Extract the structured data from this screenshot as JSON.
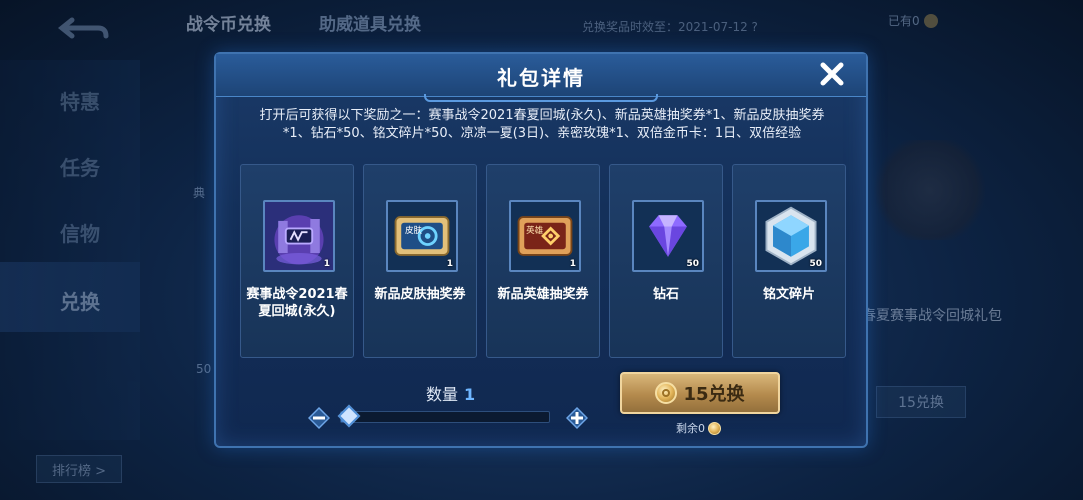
{
  "background": {
    "tabs": [
      "战令币兑换",
      "助威道具兑换"
    ],
    "top_info": "兑换奖品时效至：2021-07-12 ?",
    "top_currency": "已有0",
    "side_nav": [
      "特惠",
      "任务",
      "信物",
      "兑换"
    ],
    "rank_button": "排行榜 >",
    "left_badge": "50",
    "left_label": "典",
    "right_card_name": "赛事战令回城礼包",
    "right_card_name_visible": "春夏赛事战令回城礼包",
    "right_button": "15兑换"
  },
  "modal": {
    "title": "礼包详情",
    "description": "打开后可获得以下奖励之一：赛事战令2021春夏回城(永久)、新品英雄抽奖券*1、新品皮肤抽奖券*1、钻石*50、铭文碎片*50、凉凉一夏(3日)、亲密玫瑰*1、双倍金币卡：1日、双倍经验",
    "items": [
      {
        "name": "赛事战令2021春夏回城(永久)",
        "count": "1",
        "icon": "recall-effect-icon"
      },
      {
        "name": "新品皮肤抽奖券",
        "count": "1",
        "icon": "skin-ticket-icon"
      },
      {
        "name": "新品英雄抽奖券",
        "count": "1",
        "icon": "hero-ticket-icon"
      },
      {
        "name": "钻石",
        "count": "50",
        "icon": "diamond-icon"
      },
      {
        "name": "铭文碎片",
        "count": "50",
        "icon": "inscription-shard-icon"
      }
    ],
    "ticket_labels": {
      "skin": "皮肤",
      "hero": "英雄"
    },
    "quantity_label": "数量",
    "quantity_value": "1",
    "slider_level": 0.0,
    "exchange_label": "15兑换",
    "remaining_label": "剩余0",
    "accent_color": "#6fb6ff",
    "exchange_color": "#b48a4d"
  }
}
